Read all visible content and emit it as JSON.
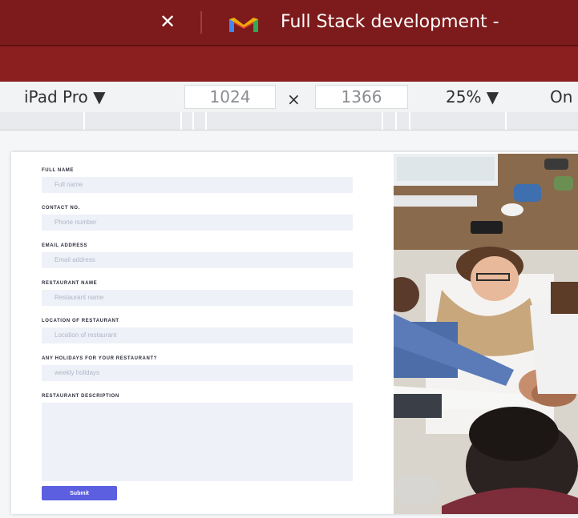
{
  "browser": {
    "tab_close_glyph": "✕",
    "tab_title": "Full Stack development -",
    "tab_icon": "gmail-icon",
    "accent_color": "#7d1a1b"
  },
  "device_toolbar": {
    "device": "iPad Pro ▼",
    "width": "1024",
    "times": "×",
    "height": "1366",
    "zoom": "25% ▼",
    "throttle": "On"
  },
  "form": {
    "fields": [
      {
        "label": "FULL NAME",
        "placeholder": "Full name"
      },
      {
        "label": "CONTACT NO.",
        "placeholder": "Phone number"
      },
      {
        "label": "EMAIL ADDRESS",
        "placeholder": "Email address"
      },
      {
        "label": "RESTAURANT NAME",
        "placeholder": "Restaurant name"
      },
      {
        "label": "LOCATION OF RESTAURANT",
        "placeholder": "Location of restaurant"
      },
      {
        "label": "ANY HOLIDAYS FOR YOUR RESTAURANT?",
        "placeholder": "weekly holidays"
      }
    ],
    "description_label": "RESTAURANT DESCRIPTION",
    "submit_label": "Submit",
    "submit_color": "#5c5fe0"
  }
}
